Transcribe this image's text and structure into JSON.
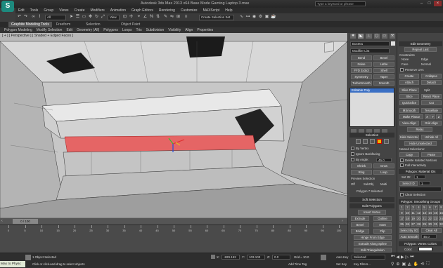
{
  "app": {
    "logo_text": "S",
    "title": "Autodesk 3ds Max  2013 x64       Base Mode Gaming Laptop 3.max",
    "search_placeholder": "Type a keyword or phrase"
  },
  "menu": [
    "Edit",
    "Tools",
    "Group",
    "Views",
    "Create",
    "Modifiers",
    "Animation",
    "Graph Editors",
    "Rendering",
    "Customize",
    "MAXScript",
    "Help"
  ],
  "toolbar": {
    "undo_icon": "undo-icon",
    "redo_icon": "redo-icon",
    "selection_filter": "All",
    "view_dropdown": "View",
    "named_selection": "Create Selection Set"
  },
  "ribbon": {
    "tabs": [
      "Graphite Modeling Tools",
      "Freeform",
      "Selection",
      "Object Paint"
    ],
    "active_tab": 0,
    "row_items": [
      "Polygon Modeling",
      "Modify Selection",
      "Edit",
      "Geometry (All)",
      "Polygons",
      "Loops",
      "Tris",
      "Subdivision",
      "Visibility",
      "Align",
      "Properties"
    ]
  },
  "viewport": {
    "label": "[ + ] [ Perspective ] [ Shaded + Edged Faces ]"
  },
  "command_panel": {
    "object_name": "Box001",
    "modifier_list": "Modifier List",
    "modifiers_left": [
      "Bend",
      "Noise",
      "FFD 3x3x3",
      "Symmetry",
      "TurboSmooth"
    ],
    "modifiers_right": [
      "Bevel",
      "Lathe",
      "Shell",
      "Taper",
      "Smooth"
    ],
    "stack_item": "Editable Poly",
    "selection": {
      "header": "Selection",
      "by_vertex": "By Vertex",
      "ignore_backfacing": "Ignore Backfacing",
      "by_angle": "By Angle:",
      "angle_value": "45.0",
      "shrink": "Shrink",
      "grow": "Grow",
      "ring": "Ring",
      "loop": "Loop",
      "preview_selection": "Preview Selection",
      "preview_off": "Off",
      "preview_subobj": "SubObj",
      "preview_multi": "Multi",
      "status": "Polygon 7 Selected"
    },
    "soft_selection": "Soft Selection",
    "edit_polygons": {
      "header": "Edit Polygons",
      "insert_vertex": "Insert Vertex",
      "rows": [
        [
          "Extrude",
          "Outline"
        ],
        [
          "Bevel",
          "Inset"
        ],
        [
          "Bridge",
          "Flip"
        ]
      ],
      "hinge": "Hinge From Edge",
      "extrude_spline": "Extrude Along Spline",
      "edit_triangulation": "Edit Triangulation",
      "retriangulate": "Retriangulate",
      "turn": "Turn"
    }
  },
  "right_panel": {
    "edit_geometry": "Edit Geometry",
    "repeat_last": "Repeat Last",
    "constraints": "Constraints",
    "constraint_none": "None",
    "constraint_edge": "Edge",
    "constraint_face": "Face",
    "constraint_normal": "Normal",
    "preserve_uvs": "Preserve UVs",
    "create": "Create",
    "collapse": "Collapse",
    "attach": "Attach",
    "detach": "Detach",
    "slice_plane": "Slice Plane",
    "split": "Split",
    "slice": "Slice",
    "reset_plane": "Reset Plane",
    "quickslice": "QuickSlice",
    "cut": "Cut",
    "msmooth": "MSmooth",
    "tessellate": "Tessellate",
    "make_planar": "Make Planar",
    "x": "X",
    "y": "Y",
    "z": "Z",
    "view_align": "View Align",
    "grid_align": "Grid Align",
    "relax": "Relax",
    "hide_selected": "Hide Selected",
    "unhide_all": "Unhide All",
    "hide_unselected": "Hide Unselected",
    "named_selections": "Named Selections:",
    "copy": "Copy",
    "paste": "Paste",
    "delete_isolated": "Delete Isolated Vertices",
    "full_interactivity": "Full Interactivity",
    "material_ids_header": "Polygon: Material IDs",
    "set_id": "Set ID:",
    "set_id_value": "1",
    "select_id": "Select ID",
    "select_id_value": "1",
    "clear_selection": "Clear Selection",
    "smoothing_groups_header": "Polygon: Smoothing Groups",
    "smoothing_groups": [
      "1",
      "2",
      "3",
      "4",
      "5",
      "6",
      "7",
      "8",
      "9",
      "10",
      "11",
      "12",
      "13",
      "14",
      "15",
      "16",
      "17",
      "18",
      "19",
      "20",
      "21",
      "22",
      "23",
      "24",
      "25",
      "26",
      "27",
      "28",
      "29",
      "30",
      "31",
      "32"
    ],
    "select_by_sg": "Select By SG",
    "clear_all": "Clear All",
    "auto_smooth": "Auto Smooth",
    "auto_smooth_value": "45.0",
    "vertex_colors_header": "Polygon: Vertex Colors",
    "color": "Color:"
  },
  "timeline": {
    "frame_label": "0 / 100",
    "ticks": [
      "0",
      "5",
      "10",
      "15",
      "20",
      "25",
      "30",
      "35",
      "40",
      "45",
      "50",
      "55",
      "60",
      "65",
      "70",
      "75",
      "80",
      "85",
      "90",
      "95",
      "100"
    ]
  },
  "status": {
    "maxscript": "Max to Physc",
    "selected": "1 Object Selected",
    "prompt": "Click or click-and-drag to select objects",
    "x_label": "X:",
    "x_value": "-829.152",
    "y_label": "Y:",
    "y_value": "103.103",
    "z_label": "Z:",
    "z_value": "0.0",
    "grid": "Grid = 10.0",
    "auto_key": "Auto Key",
    "selected_dropdown": "Selected",
    "set_key": "Set Key",
    "key_filters": "Key Filters...",
    "add_time_tag": "Add Time Tag"
  }
}
